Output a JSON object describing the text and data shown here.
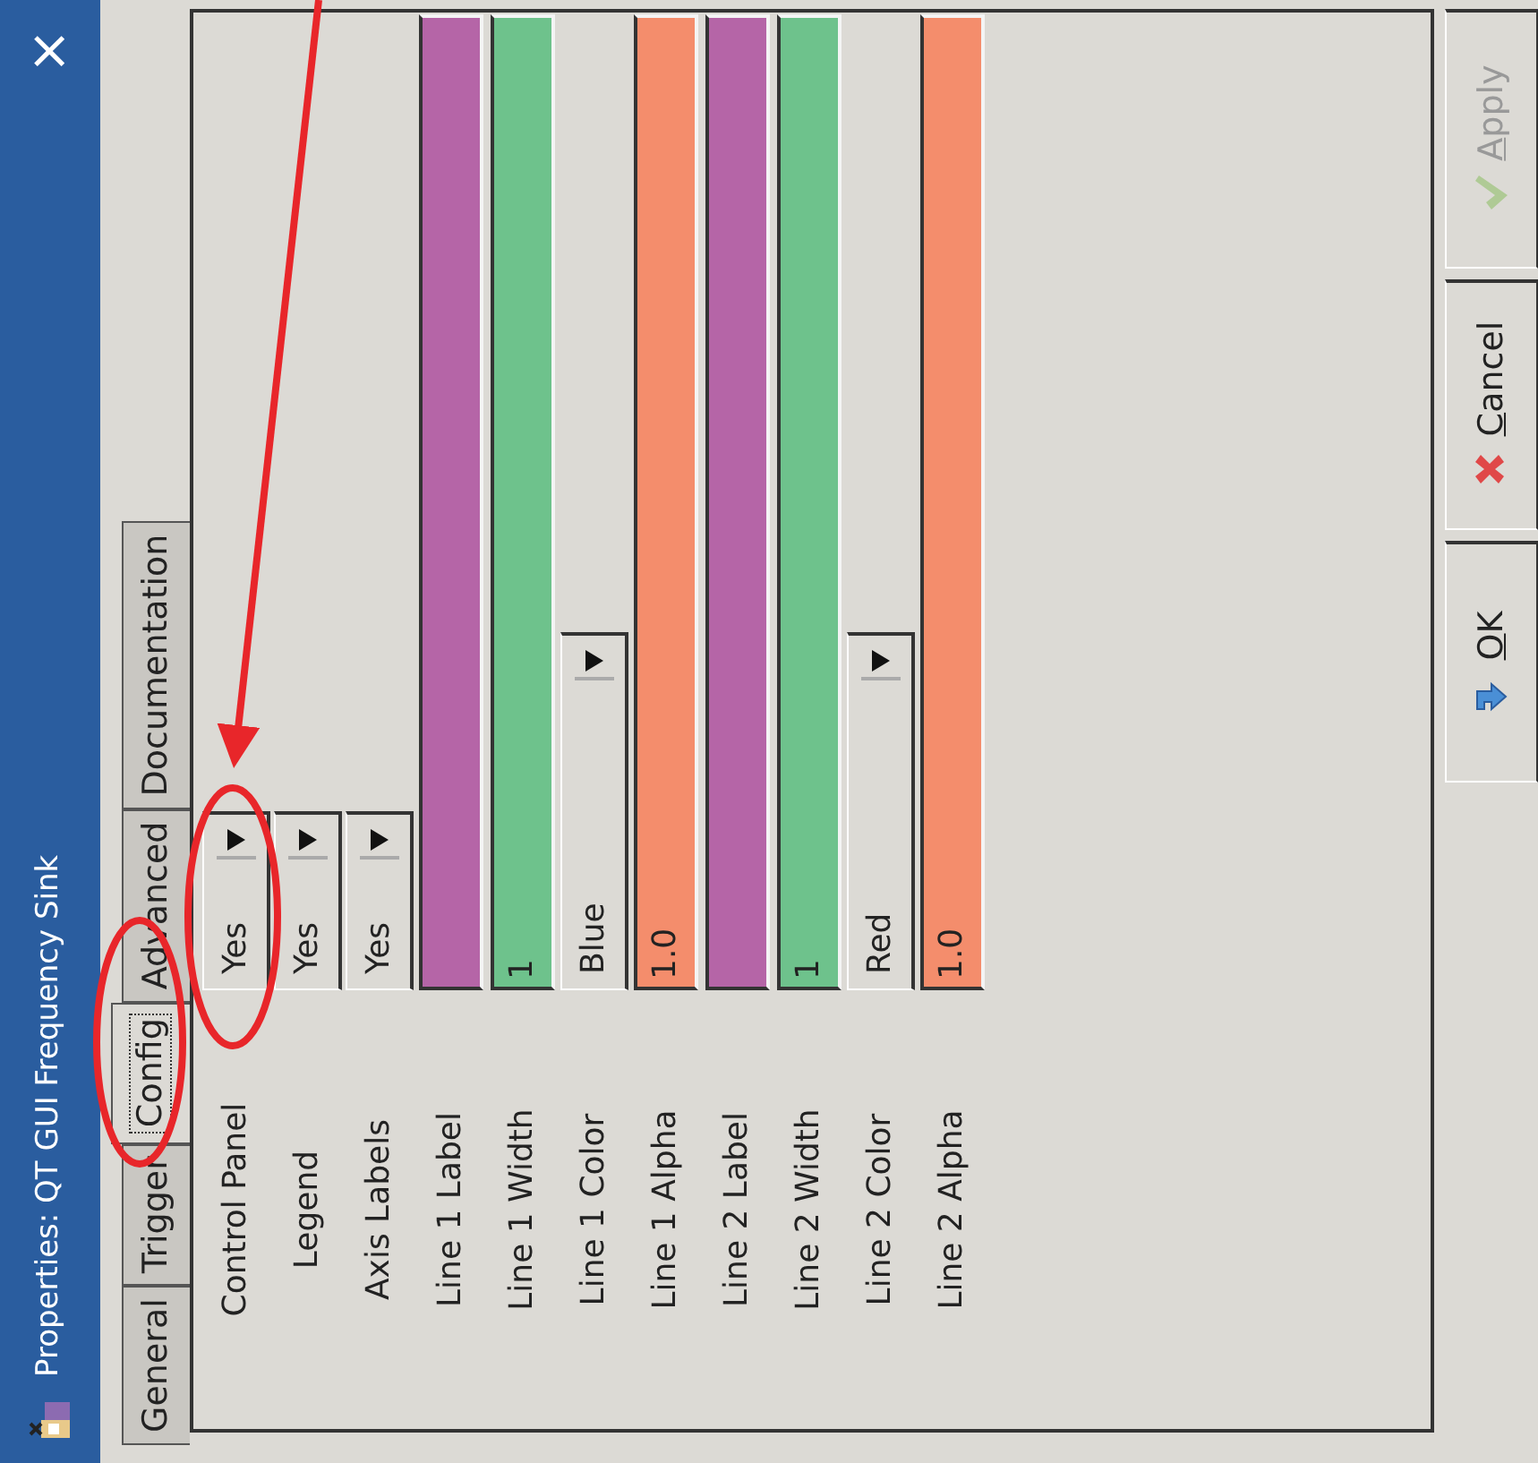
{
  "window": {
    "title": "Properties: QT GUI Frequency Sink",
    "close": "×"
  },
  "tabs": [
    {
      "label": "General",
      "selected": false
    },
    {
      "label": "Trigger",
      "selected": false
    },
    {
      "label": "Config",
      "selected": true
    },
    {
      "label": "Advanced",
      "selected": false
    },
    {
      "label": "Documentation",
      "selected": false
    }
  ],
  "params": [
    {
      "label": "Control Panel",
      "kind": "enum",
      "value": "Yes"
    },
    {
      "label": "Legend",
      "kind": "enum",
      "value": "Yes"
    },
    {
      "label": "Axis Labels",
      "kind": "enum",
      "value": "Yes"
    },
    {
      "label": "Line 1 Label",
      "kind": "entry",
      "color": "#b565a7"
    },
    {
      "label": "Line 1 Width",
      "kind": "entry",
      "value": "1",
      "color": "#6ec28c"
    },
    {
      "label": "Line 1 Color",
      "kind": "wide-enum",
      "value": "Blue"
    },
    {
      "label": "Line 1 Alpha",
      "kind": "entry",
      "value": "1.0",
      "color": "#f48d6c"
    },
    {
      "label": "Line 2 Label",
      "kind": "entry",
      "color": "#b565a7"
    },
    {
      "label": "Line 2 Width",
      "kind": "entry",
      "value": "1",
      "color": "#6ec28c"
    },
    {
      "label": "Line 2 Color",
      "kind": "wide-enum",
      "value": "Red"
    },
    {
      "label": "Line 2 Alpha",
      "kind": "entry",
      "value": "1.0",
      "color": "#f48d6c"
    }
  ],
  "buttons": [
    {
      "label": "OK",
      "kind": "ok",
      "disabled": false
    },
    {
      "label": "Cancel",
      "kind": "cancel",
      "disabled": false
    },
    {
      "label": "Apply",
      "kind": "apply",
      "disabled": true
    }
  ]
}
